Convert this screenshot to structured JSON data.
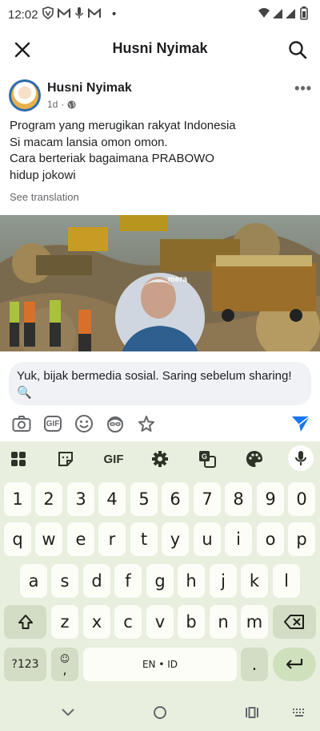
{
  "status": {
    "time": "12:02",
    "dot": "•"
  },
  "header": {
    "title": "Husni Nyimak"
  },
  "post": {
    "author": "Husni Nyimak",
    "time": "1d",
    "separator": "·",
    "text_lines": [
      "Program yang merugikan rakyat Indonesia",
      "Si macam lansia omon omon.",
      "Cara berteriak bagaimana PRABOWO",
      "hidup jokowi"
    ],
    "see_translation": "See translation",
    "image_overlay_text": "mera"
  },
  "reply": {
    "text": "Yuk, bijak bermedia sosial. Saring sebelum sharing! 🔍",
    "gif_label": "GIF"
  },
  "keyboard": {
    "toolbar": {
      "gif_label": "GIF"
    },
    "row_numbers": [
      "1",
      "2",
      "3",
      "4",
      "5",
      "6",
      "7",
      "8",
      "9",
      "0"
    ],
    "row_q": [
      "q",
      "w",
      "e",
      "r",
      "t",
      "y",
      "u",
      "i",
      "o",
      "p"
    ],
    "row_a": [
      "a",
      "s",
      "d",
      "f",
      "g",
      "h",
      "j",
      "k",
      "l"
    ],
    "row_z": [
      "z",
      "x",
      "c",
      "v",
      "b",
      "n",
      "m"
    ],
    "symbols_label": "?123",
    "comma_label": ",",
    "emoji_label": "☺",
    "space_label": "EN • ID",
    "period_label": "."
  }
}
